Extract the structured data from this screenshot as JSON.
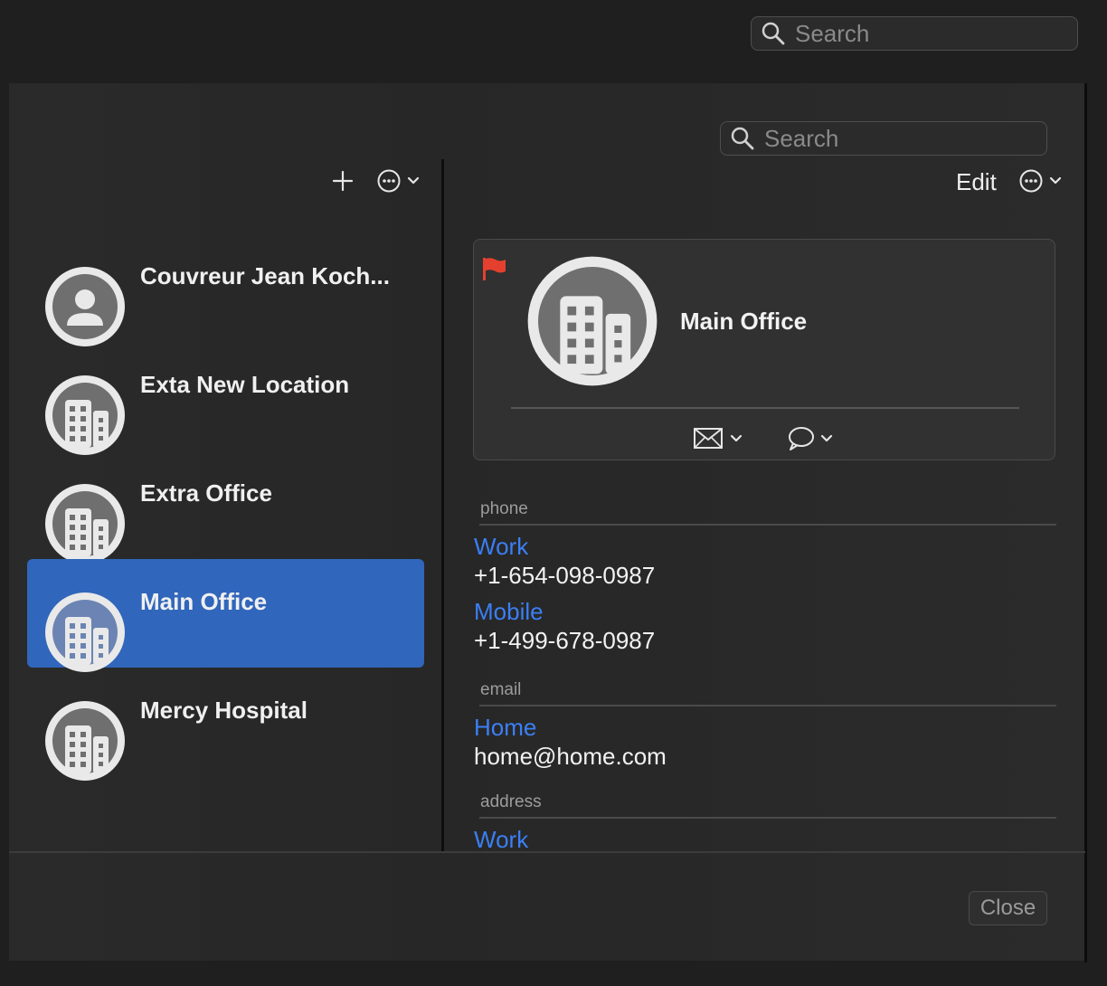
{
  "top_search": {
    "placeholder": "Search"
  },
  "inner_search": {
    "placeholder": "Search"
  },
  "list_toolbar": {
    "add_icon": "plus-icon",
    "more_icon": "ellipsis-circle-icon"
  },
  "detail_toolbar": {
    "edit_label": "Edit",
    "more_icon": "ellipsis-circle-icon"
  },
  "contacts": [
    {
      "name": "Couvreur Jean Koch...",
      "icon": "person-icon",
      "selected": false
    },
    {
      "name": "Exta New Location",
      "icon": "building-icon",
      "selected": false
    },
    {
      "name": "Extra Office",
      "icon": "building-icon",
      "selected": false
    },
    {
      "name": "Main Office",
      "icon": "building-icon",
      "selected": true
    },
    {
      "name": "Mercy Hospital",
      "icon": "building-icon",
      "selected": false
    }
  ],
  "card": {
    "name": "Main Office",
    "flag_color": "#e5402f",
    "actions": [
      "mail-icon",
      "message-icon"
    ]
  },
  "details": {
    "phone_label": "phone",
    "phones": [
      {
        "kind": "Work",
        "value": "+1-654-098-0987"
      },
      {
        "kind": "Mobile",
        "value": "+1-499-678-0987"
      }
    ],
    "email_label": "email",
    "emails": [
      {
        "kind": "Home",
        "value": "home@home.com"
      }
    ],
    "address_label": "address",
    "addresses": [
      {
        "kind": "Work"
      }
    ]
  },
  "footer": {
    "close_label": "Close"
  },
  "colors": {
    "accent": "#3066bb",
    "link": "#3b7ff5"
  }
}
